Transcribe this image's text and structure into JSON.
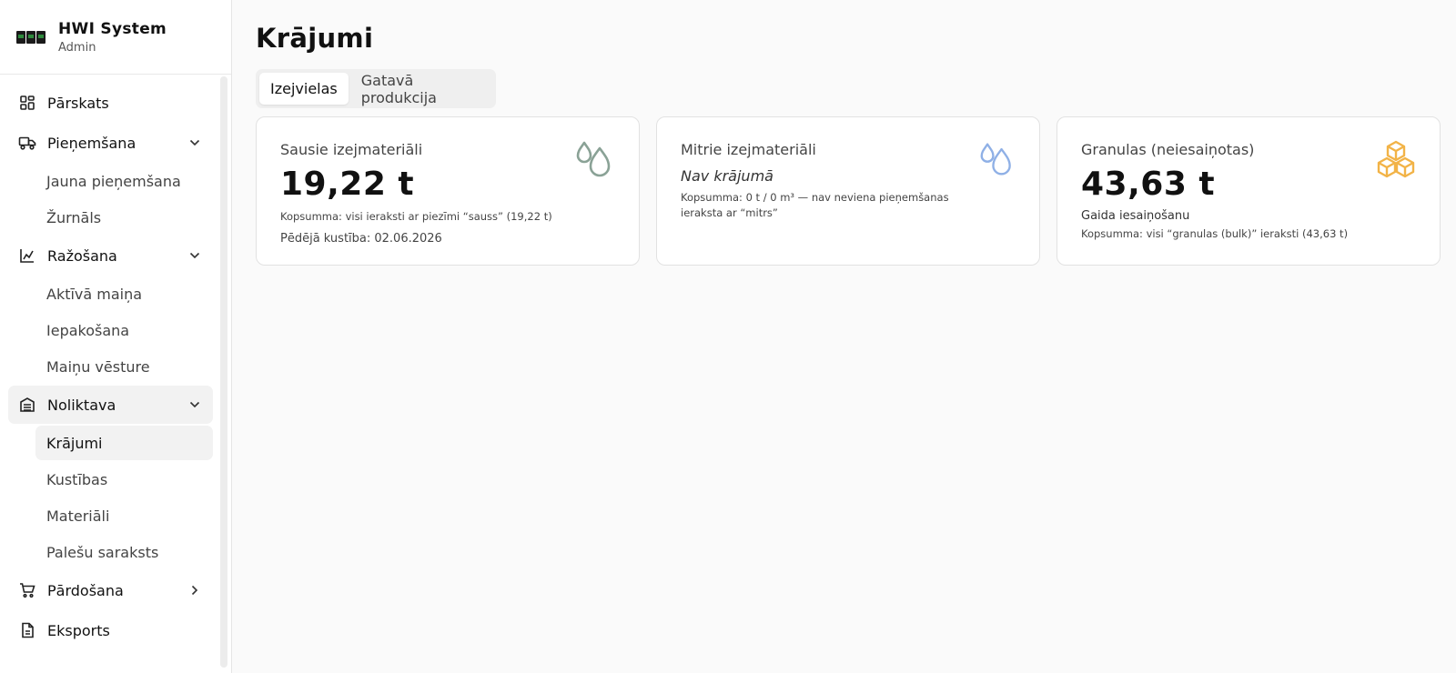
{
  "brand": {
    "title": "HWI System",
    "subtitle": "Admin"
  },
  "nav": {
    "overview": "Pārskats",
    "receiving": {
      "label": "Pieņemšana",
      "items": [
        "Jauna pieņemšana",
        "Žurnāls"
      ]
    },
    "production": {
      "label": "Ražošana",
      "items": [
        "Aktīvā maiņa",
        "Iepakošana",
        "Maiņu vēsture"
      ]
    },
    "warehouse": {
      "label": "Noliktava",
      "items": [
        "Krājumi",
        "Kustības",
        "Materiāli",
        "Palešu saraksts"
      ]
    },
    "sales": "Pārdošana",
    "export": "Eksports"
  },
  "page": {
    "title": "Krājumi",
    "tabs": [
      "Izejvielas",
      "Gatavā produkcija"
    ]
  },
  "cards": {
    "dry": {
      "title": "Sausie izejmateriāli",
      "value": "19,22 t",
      "note": "Kopsumma: visi ieraksti ar piezīmi “sauss” (19,22 t)",
      "foot": "Pēdējā kustība: 02.06.2026",
      "icon": "droplets-icon",
      "icon_color": "#8aa296"
    },
    "wet": {
      "title": "Mitrie izejmateriāli",
      "empty": "Nav krājumā",
      "note": "Kopsumma: 0 t / 0 m³ — nav neviena pieņemšanas ieraksta ar “mitrs”",
      "icon": "droplets-icon",
      "icon_color": "#8fb0e6"
    },
    "granules": {
      "title": "Granulas (neiesaiņotas)",
      "value": "43,63 t",
      "sub": "Gaida iesaiņošanu",
      "note": "Kopsumma: visi “granulas (bulk)” ieraksti (43,63 t)",
      "icon": "boxes-icon",
      "icon_color": "#f2b347"
    }
  }
}
